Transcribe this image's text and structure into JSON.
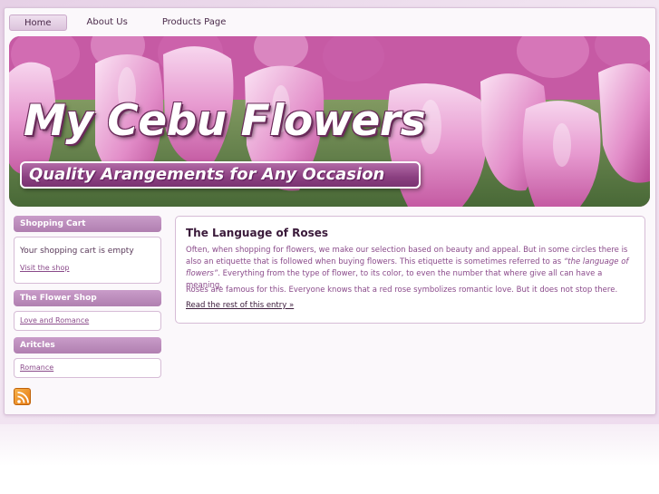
{
  "nav": {
    "tabs": [
      {
        "label": "Home",
        "active": true
      },
      {
        "label": "About Us",
        "active": false
      },
      {
        "label": "Products Page",
        "active": false
      }
    ]
  },
  "banner": {
    "title": "My Cebu Flowers",
    "tagline": "Quality Arangements for Any Occasion"
  },
  "sidebar": {
    "cart": {
      "heading": "Shopping Cart",
      "text": "Your shopping cart is empty",
      "link": "Visit the shop"
    },
    "shop": {
      "heading": "The Flower Shop",
      "link": "Love and Romance"
    },
    "articles": {
      "heading": "Aritcles",
      "link": "Romance"
    },
    "rss_icon": "rss-feed-icon"
  },
  "post": {
    "title": "The Language of Roses",
    "p1_a": "Often, when shopping for flowers, we make our selection based on beauty and appeal. But in some circles there is also an etiquette that is followed when buying flowers. This etiquette is sometimes referred to as ",
    "p1_em": "“the language of flowers”",
    "p1_b": ". Everything from the type of flower, to its color, to even the number that where give all can have a meaning.",
    "p2": "Roses are famous for this. Everyone knows that a red rose symbolizes romantic love. But it does not stop there.",
    "read_more": "Read the rest of this entry »"
  },
  "colors": {
    "accent": "#b07fb0",
    "link": "#8a4a8a",
    "heading": "#3a1a3a"
  }
}
